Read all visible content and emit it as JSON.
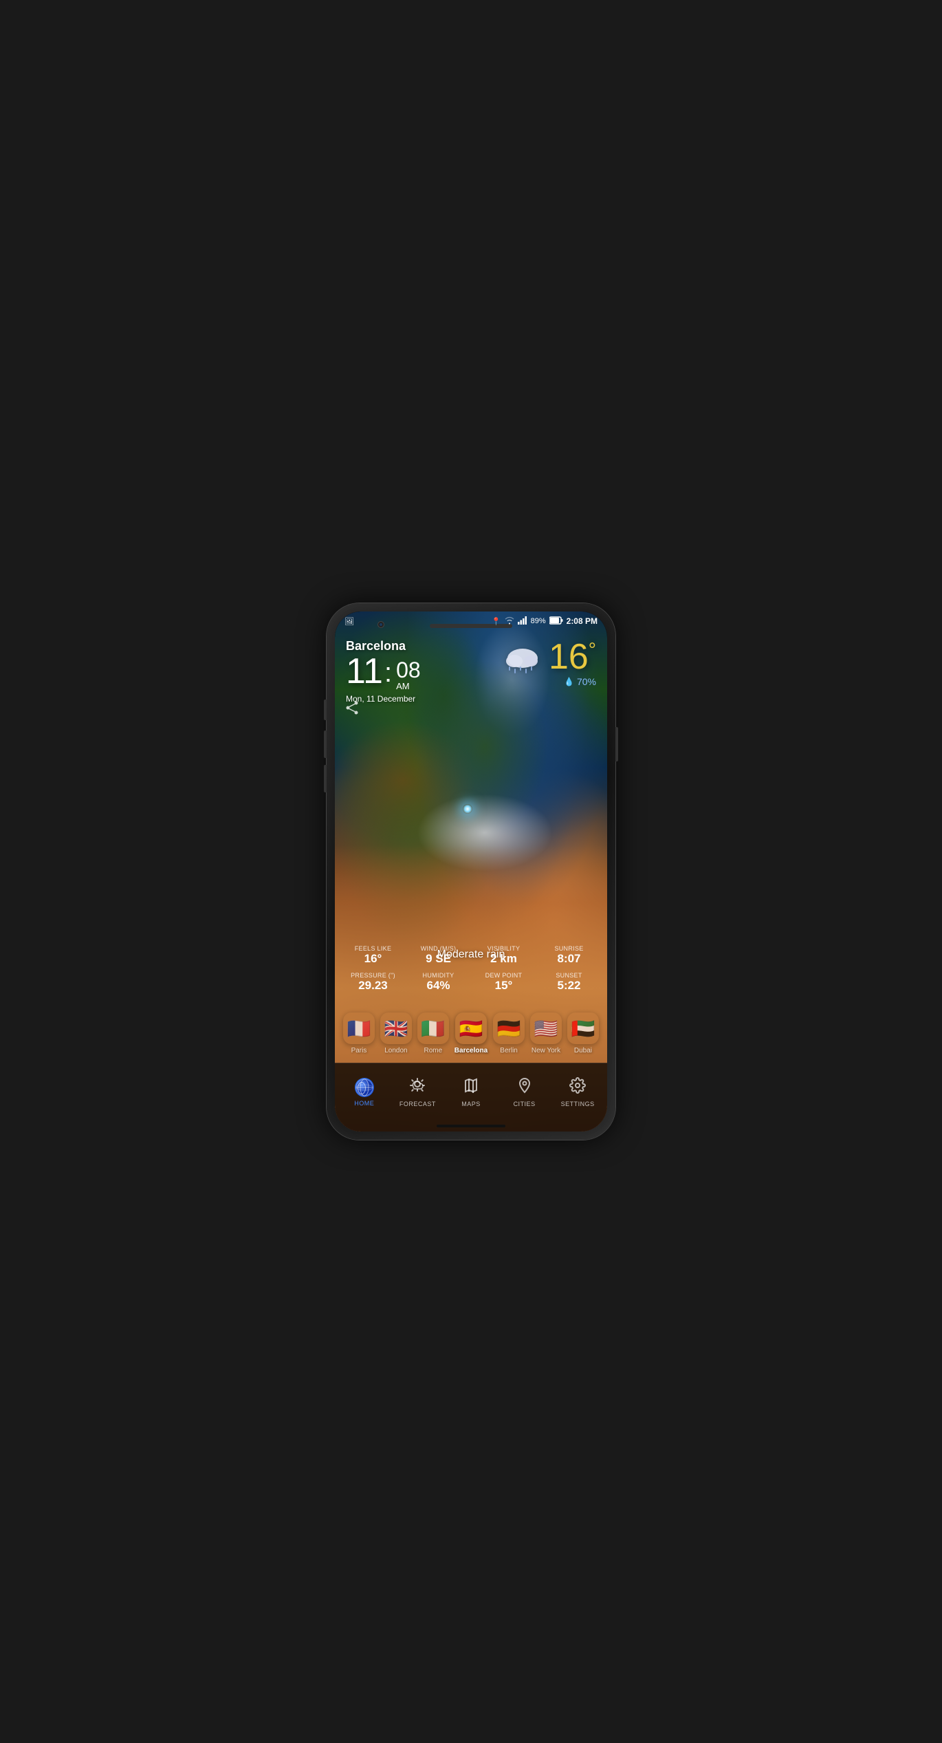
{
  "phone": {
    "status_bar": {
      "location_icon": "📍",
      "wifi_icon": "wifi",
      "signal_icon": "signal",
      "battery": "89%",
      "time": "2:08 PM"
    },
    "weather": {
      "city": "Barcelona",
      "time_hours": "11",
      "time_colon": ":",
      "time_minutes": "08",
      "time_ampm": "AM",
      "date": "Mon, 11 December",
      "temp": "16",
      "temp_unit": "°",
      "humidity_pct": "70%",
      "condition": "Moderate rain",
      "feels_like_label": "Feels like",
      "feels_like_value": "16°",
      "wind_label": "Wind (m/s)",
      "wind_value": "9 SE",
      "visibility_label": "Visibility",
      "visibility_value": "2 km",
      "sunrise_label": "Sunrise",
      "sunrise_value": "8:07",
      "pressure_label": "Pressure (\")",
      "pressure_value": "29.23",
      "humidity_label": "Humidity",
      "humidity_value": "64%",
      "dew_point_label": "Dew Point",
      "dew_point_value": "15°",
      "sunset_label": "Sunset",
      "sunset_value": "5:22"
    },
    "cities": [
      {
        "name": "Paris",
        "flag": "🇫🇷",
        "active": false
      },
      {
        "name": "London",
        "flag": "🇬🇧",
        "active": false
      },
      {
        "name": "Rome",
        "flag": "🇮🇹",
        "active": false
      },
      {
        "name": "Barcelona",
        "flag": "🇪🇸",
        "active": true
      },
      {
        "name": "Berlin",
        "flag": "🇩🇪",
        "active": false
      },
      {
        "name": "New York",
        "flag": "🇺🇸",
        "active": false
      },
      {
        "name": "Dubai",
        "flag": "🇦🇪",
        "active": false
      }
    ],
    "nav": [
      {
        "id": "home",
        "label": "HOME",
        "active": true
      },
      {
        "id": "forecast",
        "label": "FORECAST",
        "active": false
      },
      {
        "id": "maps",
        "label": "MAPS",
        "active": false
      },
      {
        "id": "cities",
        "label": "CITIES",
        "active": false
      },
      {
        "id": "settings",
        "label": "SETTINGS",
        "active": false
      }
    ]
  }
}
